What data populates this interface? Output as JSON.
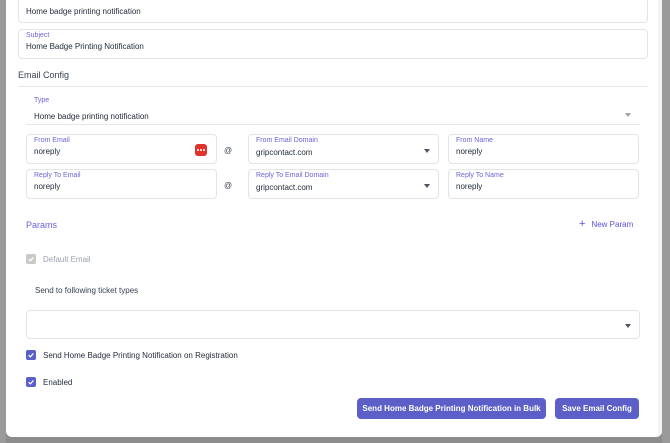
{
  "top_field": {
    "value": "Home badge printing notification"
  },
  "subject": {
    "label": "Subject",
    "value": "Home Badge Printing Notification"
  },
  "email_config": {
    "title": "Email Config",
    "type": {
      "label": "Type",
      "value": "Home badge printing notification"
    },
    "from_email": {
      "label": "From Email",
      "value": "noreply"
    },
    "from_email_domain": {
      "label": "From Email Domain",
      "value": "gripcontact.com"
    },
    "from_name": {
      "label": "From Name",
      "value": "noreply"
    },
    "reply_to_email": {
      "label": "Reply To Email",
      "value": "noreply"
    },
    "reply_to_email_domain": {
      "label": "Reply To Email Domain",
      "value": "gripcontact.com"
    },
    "reply_to_name": {
      "label": "Reply To Name",
      "value": "noreply"
    },
    "at_symbol": "@"
  },
  "params": {
    "title": "Params",
    "new_param_label": "New Param"
  },
  "default_email": {
    "label": "Default Email",
    "checked": true,
    "disabled": true
  },
  "ticket_types": {
    "title": "Send to following ticket types",
    "value": ""
  },
  "send_on_registration": {
    "label": "Send Home Badge Printing Notification on Registration",
    "checked": true
  },
  "enabled": {
    "label": "Enabled",
    "checked": true
  },
  "buttons": {
    "send_bulk": "Send Home Badge Printing Notification in Bulk",
    "save": "Save Email Config"
  },
  "colors": {
    "accent": "#5b5fc7",
    "label": "#6b63d9",
    "password_badge": "#e0332e"
  },
  "icons": {
    "password_manager": "password-manager-icon",
    "chevron": "chevron-down-icon",
    "plus": "plus-icon",
    "check": "check-icon"
  }
}
